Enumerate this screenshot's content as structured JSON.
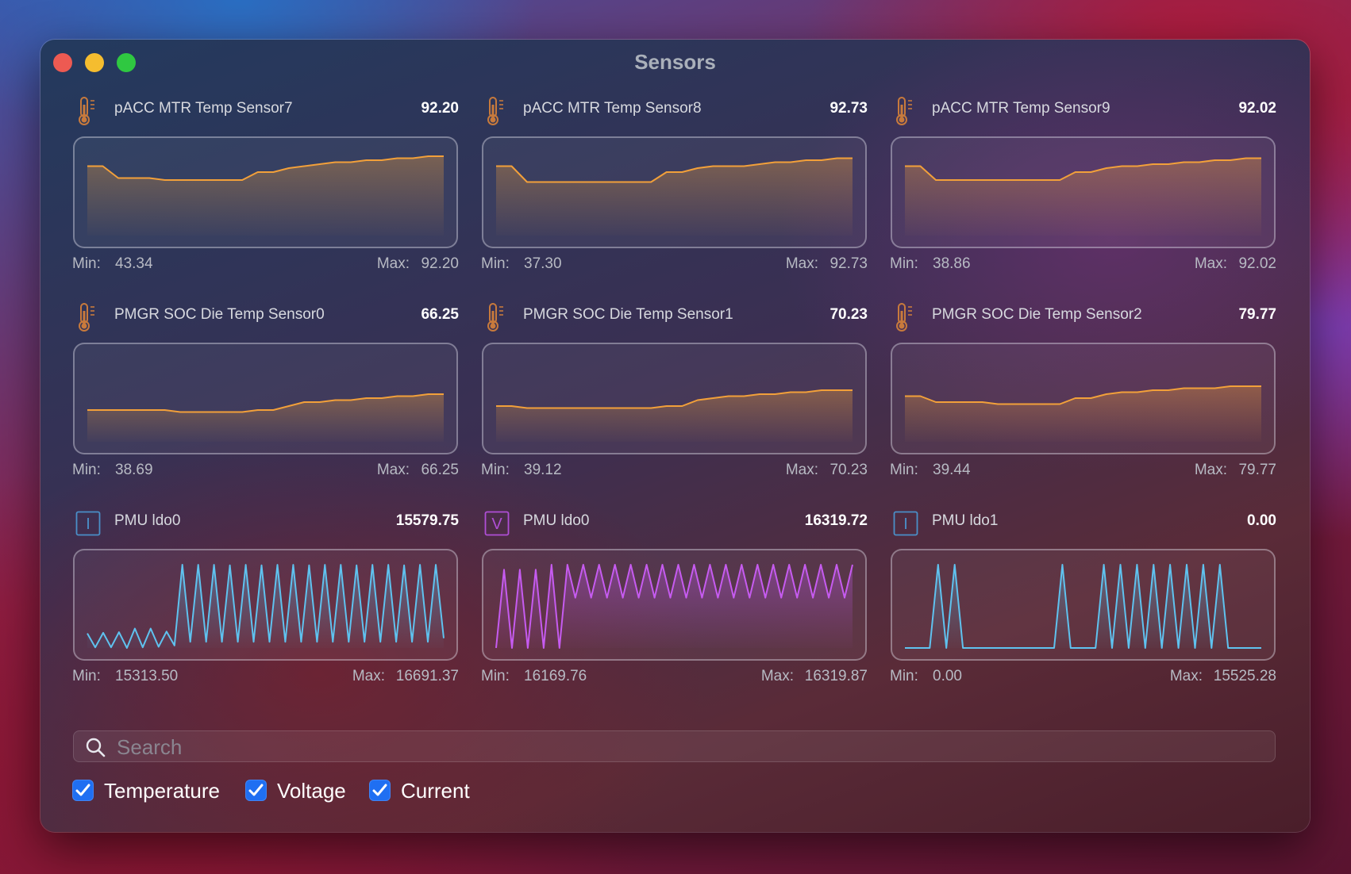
{
  "window": {
    "title": "Sensors"
  },
  "sensors": [
    {
      "name": "pACC MTR Temp Sensor7",
      "value": "92.20",
      "min": "43.34",
      "max": "92.20",
      "type": "temperature",
      "color": "#f2a03a",
      "series": [
        75,
        75,
        69,
        69,
        69,
        68,
        68,
        68,
        68,
        68,
        68,
        72,
        72,
        74,
        75,
        76,
        77,
        77,
        78,
        78,
        79,
        79,
        80,
        80
      ]
    },
    {
      "name": "pACC MTR Temp Sensor8",
      "value": "92.73",
      "min": "37.30",
      "max": "92.73",
      "type": "temperature",
      "color": "#f2a03a",
      "series": [
        75,
        75,
        67,
        67,
        67,
        67,
        67,
        67,
        67,
        67,
        67,
        72,
        72,
        74,
        75,
        75,
        75,
        76,
        77,
        77,
        78,
        78,
        79,
        79
      ]
    },
    {
      "name": "pACC MTR Temp Sensor9",
      "value": "92.02",
      "min": "38.86",
      "max": "92.02",
      "type": "temperature",
      "color": "#f2a03a",
      "series": [
        75,
        75,
        68,
        68,
        68,
        68,
        68,
        68,
        68,
        68,
        68,
        72,
        72,
        74,
        75,
        75,
        76,
        76,
        77,
        77,
        78,
        78,
        79,
        79
      ]
    },
    {
      "name": "PMGR SOC Die Temp Sensor0",
      "value": "66.25",
      "min": "38.69",
      "max": "66.25",
      "type": "temperature",
      "color": "#f2a03a",
      "series": [
        56,
        56,
        56,
        56,
        56,
        56,
        55,
        55,
        55,
        55,
        55,
        56,
        56,
        58,
        60,
        60,
        61,
        61,
        62,
        62,
        63,
        63,
        64,
        64
      ]
    },
    {
      "name": "PMGR SOC Die Temp Sensor1",
      "value": "70.23",
      "min": "39.12",
      "max": "70.23",
      "type": "temperature",
      "color": "#f2a03a",
      "series": [
        58,
        58,
        57,
        57,
        57,
        57,
        57,
        57,
        57,
        57,
        57,
        58,
        58,
        61,
        62,
        63,
        63,
        64,
        64,
        65,
        65,
        66,
        66,
        66
      ]
    },
    {
      "name": "PMGR SOC Die Temp Sensor2",
      "value": "79.77",
      "min": "39.44",
      "max": "79.77",
      "type": "temperature",
      "color": "#f2a03a",
      "series": [
        63,
        63,
        60,
        60,
        60,
        60,
        59,
        59,
        59,
        59,
        59,
        62,
        62,
        64,
        65,
        65,
        66,
        66,
        67,
        67,
        67,
        68,
        68,
        68
      ]
    },
    {
      "name": "PMU ldo0",
      "value": "15579.75",
      "min": "15313.50",
      "max": "16691.37",
      "type": "current",
      "color": "#5fc2ef",
      "series": [
        15560,
        15330,
        15570,
        15330,
        15580,
        15320,
        15640,
        15330,
        15640,
        15340,
        15590,
        15360,
        16691,
        15420,
        16690,
        15420,
        16690,
        15420,
        16680,
        15420,
        16690,
        15420,
        16680,
        15420,
        16690,
        15420,
        16690,
        15420,
        16680,
        15420,
        16690,
        15420,
        16690,
        15420,
        16680,
        15420,
        16690,
        15420,
        16690,
        15420,
        16680,
        15420,
        16690,
        15420,
        16690,
        15480
      ]
    },
    {
      "name": "PMU ldo0",
      "value": "16319.72",
      "min": "16169.76",
      "max": "16319.87",
      "type": "voltage",
      "color": "#c65bf0",
      "series": [
        16170,
        16310,
        16170,
        16310,
        16170,
        16310,
        16170,
        16319,
        16170,
        16319,
        16260,
        16319,
        16260,
        16319,
        16260,
        16319,
        16260,
        16319,
        16260,
        16319,
        16260,
        16319,
        16260,
        16319,
        16260,
        16319,
        16260,
        16319,
        16260,
        16319,
        16260,
        16319,
        16260,
        16319,
        16260,
        16319,
        16260,
        16319,
        16260,
        16319,
        16260,
        16319,
        16260,
        16319,
        16260,
        16319
      ]
    },
    {
      "name": "PMU ldo1",
      "value": "0.00",
      "min": "0.00",
      "max": "15525.28",
      "type": "current",
      "color": "#5fc2ef",
      "series": [
        0,
        0,
        0,
        0,
        15525,
        0,
        15525,
        0,
        0,
        0,
        0,
        0,
        0,
        0,
        0,
        0,
        0,
        0,
        0,
        15525,
        0,
        0,
        0,
        0,
        15525,
        0,
        15525,
        0,
        15525,
        0,
        15525,
        0,
        15525,
        0,
        15525,
        0,
        15525,
        0,
        15525,
        0,
        0,
        0,
        0,
        0
      ]
    }
  ],
  "labels": {
    "min": "Min:",
    "max": "Max:"
  },
  "search": {
    "placeholder": "Search"
  },
  "filters": [
    {
      "label": "Temperature",
      "checked": true
    },
    {
      "label": "Voltage",
      "checked": true
    },
    {
      "label": "Current",
      "checked": true
    }
  ]
}
